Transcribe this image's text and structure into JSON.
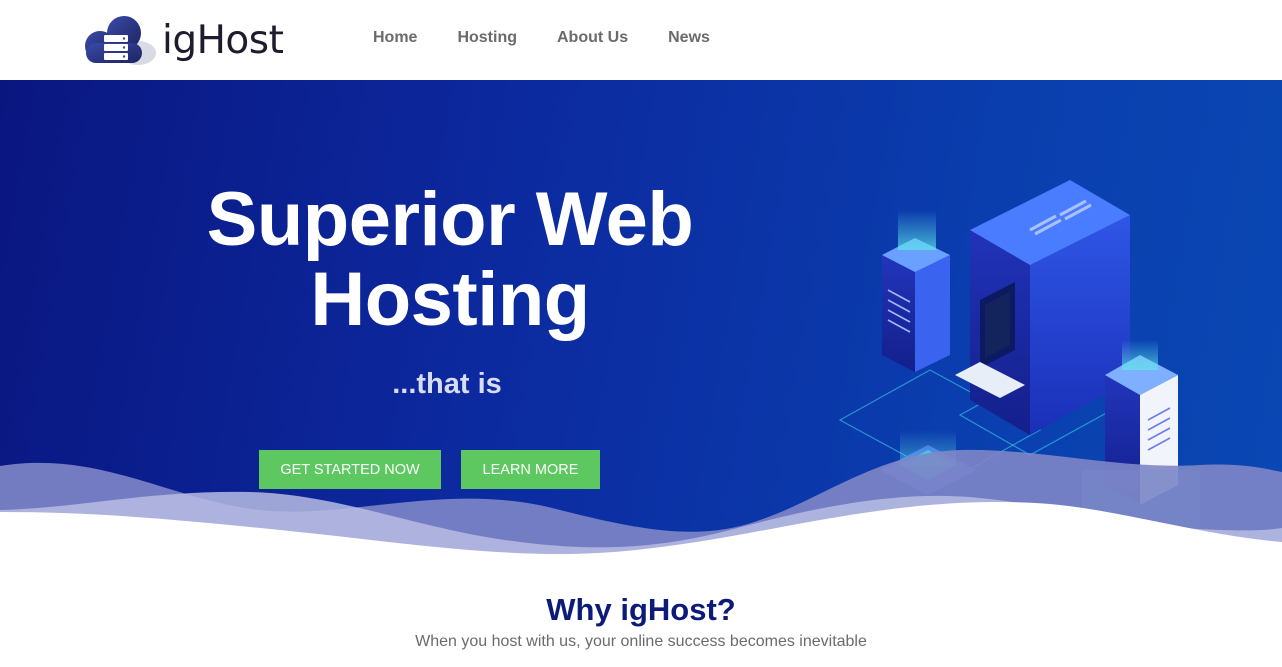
{
  "header": {
    "logo_text": "igHost",
    "nav": [
      "Home",
      "Hosting",
      "About Us",
      "News"
    ]
  },
  "hero": {
    "title_line1": "Superior Web",
    "title_line2": "Hosting",
    "subtitle": "...that is",
    "primary_button": "GET STARTED NOW",
    "secondary_button": "LEARN MORE"
  },
  "why": {
    "title": "Why igHost?",
    "subtitle": "When you host with us, your online success becomes inevitable"
  },
  "icons": [
    "cloud-server-logo-icon",
    "server-isometric-illustration"
  ],
  "colors": {
    "hero_start": "#0a1680",
    "hero_end": "#0a48b4",
    "button_green": "#5cc85f",
    "why_title": "#0c1a7a",
    "nav_text": "#6b6b6b"
  }
}
